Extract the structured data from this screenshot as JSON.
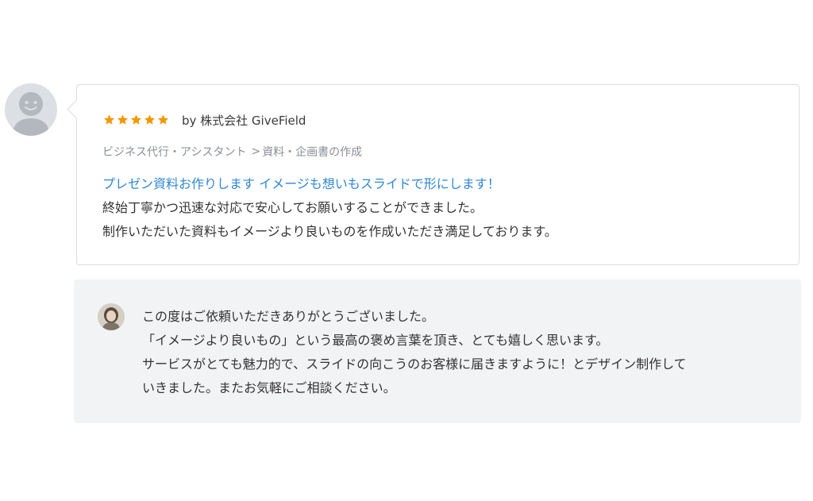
{
  "review": {
    "avatar_icon": "default-user-avatar-icon",
    "rating": 5,
    "rating_max": 5,
    "star_color": "#f39800",
    "reviewer": "by 株式会社 GiveField",
    "category": {
      "parent": "ビジネス代行・アシスタント",
      "separator": ">",
      "child": "資料・企画書の作成"
    },
    "service_title": "プレゼン資料お作りします イメージも想いもスライドで形にします！",
    "lines": [
      "終始丁寧かつ迅速な対応で安心してお願いすることができました。",
      "制作いただいた資料もイメージより良いものを作成いただき満足しております。"
    ]
  },
  "reply": {
    "avatar_icon": "seller-avatar-icon",
    "lines": [
      "この度はご依頼いただきありがとうございました。",
      "「イメージより良いもの」という最高の褒め言葉を頂き、とても嬉しく思います。",
      "サービスがとても魅力的で、スライドの向こうのお客様に届きますように！とデザイン制作して",
      "いきました。またお気軽にご相談ください。"
    ]
  }
}
